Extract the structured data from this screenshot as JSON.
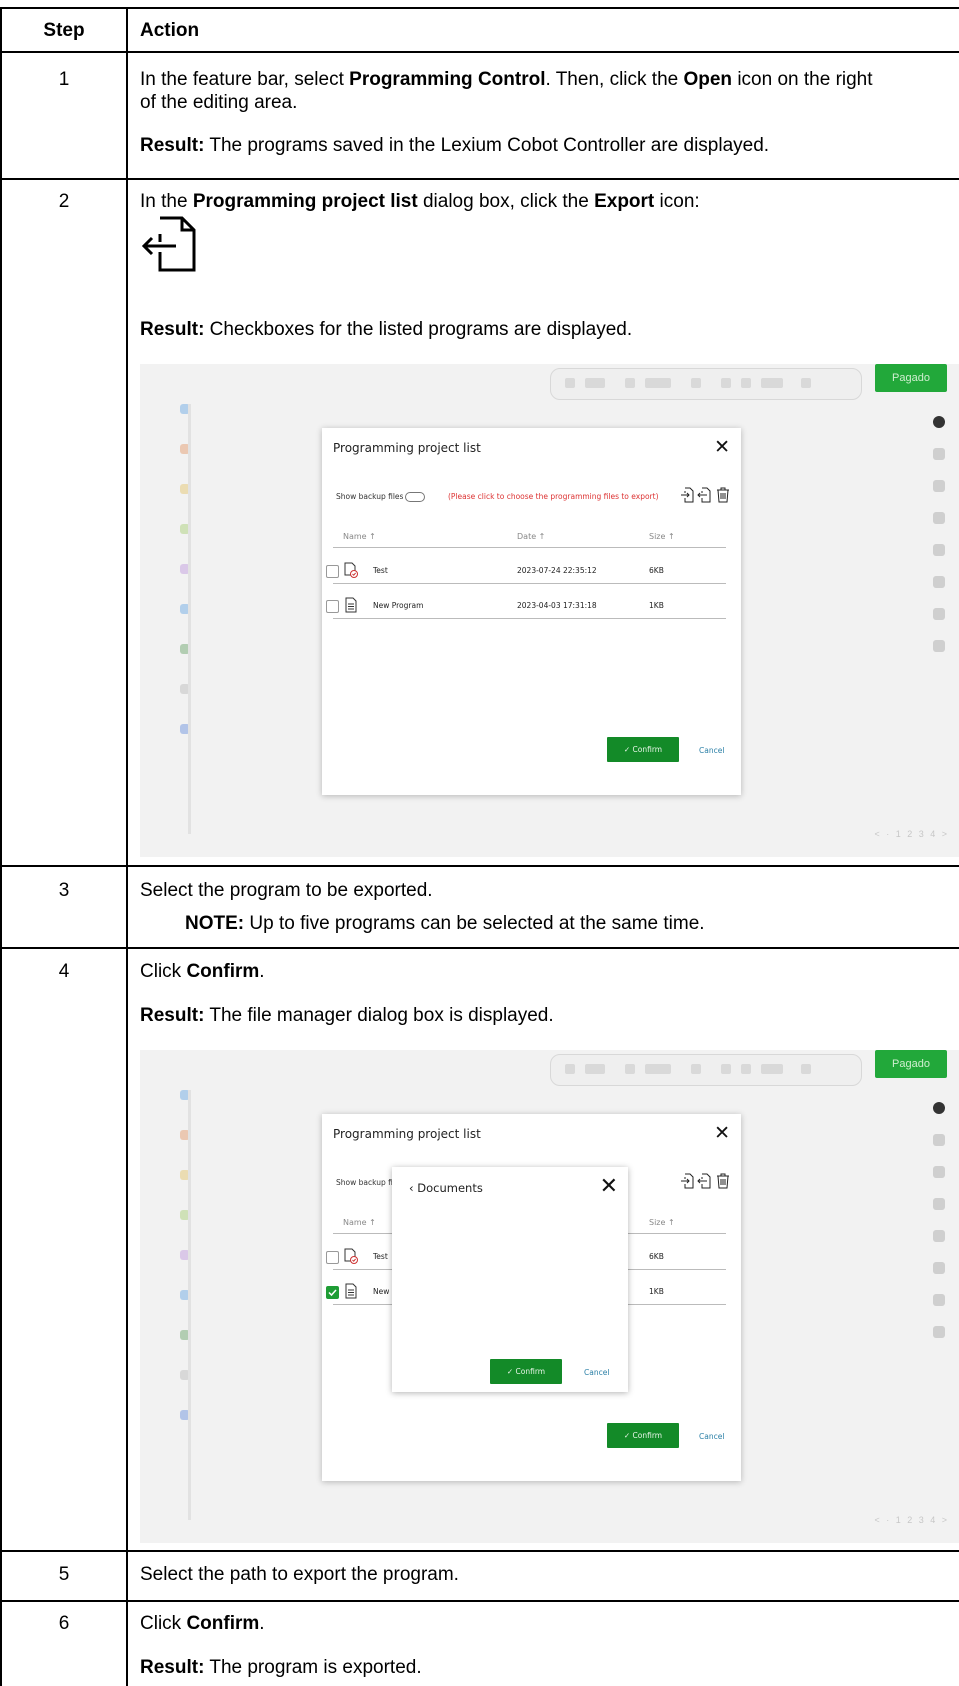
{
  "header": {
    "step": "Step",
    "action": "Action"
  },
  "rows": {
    "r1": {
      "num": "1",
      "line1_a": "In the feature bar, select ",
      "line1_b": "Programming Control",
      "line1_c": ". Then, click the ",
      "line1_d": "Open",
      "line1_e": " icon on the right",
      "line2": "of the editing area.",
      "result_label": "Result:",
      "result_text": " The programs saved in the Lexium Cobot Controller are displayed."
    },
    "r2": {
      "num": "2",
      "text_a": "In the ",
      "text_b": "Programming project list",
      "text_c": " dialog box, click the ",
      "text_d": "Export",
      "text_e": " icon:",
      "result_label": "Result:",
      "result_text": " Checkboxes for the listed programs are displayed."
    },
    "r3": {
      "num": "3",
      "text": "Select the program to be exported.",
      "note_label": "NOTE:",
      "note_text": " Up to five programs can be selected at the same time."
    },
    "r4": {
      "num": "4",
      "text_a": "Click ",
      "text_b": "Confirm",
      "text_c": ".",
      "result_label": "Result:",
      "result_text": " The file manager dialog box is displayed."
    },
    "r5": {
      "num": "5",
      "text": "Select the path to export the program."
    },
    "r6": {
      "num": "6",
      "text_a": "Click ",
      "text_b": "Confirm",
      "text_c": ".",
      "result_label": "Result:",
      "result_text": " The program is exported."
    }
  },
  "dialog": {
    "title": "Programming project list",
    "close": "✕",
    "backup_label": "Show backup files",
    "hint": "(Please click to choose the programming files to export)",
    "columns": {
      "name": "Name ↑",
      "date": "Date ↑",
      "size": "Size ↑"
    },
    "files": [
      {
        "name": "Test",
        "date": "2023-07-24 22:35:12",
        "size": "6KB",
        "checked": false
      },
      {
        "name": "New Program",
        "date": "2023-04-03 17:31:18",
        "size": "1KB",
        "checked": true
      }
    ],
    "confirm": "✓ Confirm",
    "cancel": "Cancel",
    "truncated_name": "New Prog"
  },
  "file_manager": {
    "title": "‹  Documents",
    "close": "✕",
    "confirm": "✓ Confirm",
    "cancel": "Cancel"
  },
  "app": {
    "top_button": "Pagado",
    "pagination": "< · 1 2 3 4 >"
  },
  "colors": {
    "confirm_green": "#138a28",
    "hint_red": "#dd3333",
    "cancel_blue": "#2a7fa6"
  },
  "icons": [
    "export-icon",
    "import-icon",
    "trash-icon",
    "file-check-icon",
    "file-icon"
  ]
}
